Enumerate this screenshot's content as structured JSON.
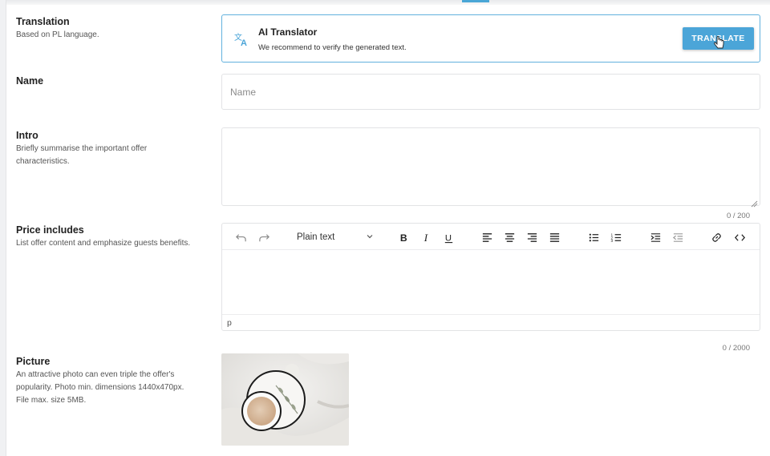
{
  "translation": {
    "label": "Translation",
    "description": "Based on PL language.",
    "ai_title": "AI Translator",
    "ai_subtitle": "We recommend to verify the generated text.",
    "button_label": "TRANSLATE"
  },
  "name": {
    "label": "Name",
    "placeholder": "Name",
    "value": ""
  },
  "intro": {
    "label": "Intro",
    "description": "Briefly summarise the important offer characteristics.",
    "counter": "0 / 200"
  },
  "price": {
    "label": "Price includes",
    "description": "List offer content and emphasize guests benefits.",
    "format_value": "Plain text",
    "status_path": "p",
    "counter": "0 / 2000"
  },
  "picture": {
    "label": "Picture",
    "description": "An attractive photo can even triple the offer's popularity. Photo min. dimensions 1440x470px. File max. size 5MB."
  },
  "colors": {
    "accent": "#4ba5d8",
    "border": "#e2e3e5"
  }
}
